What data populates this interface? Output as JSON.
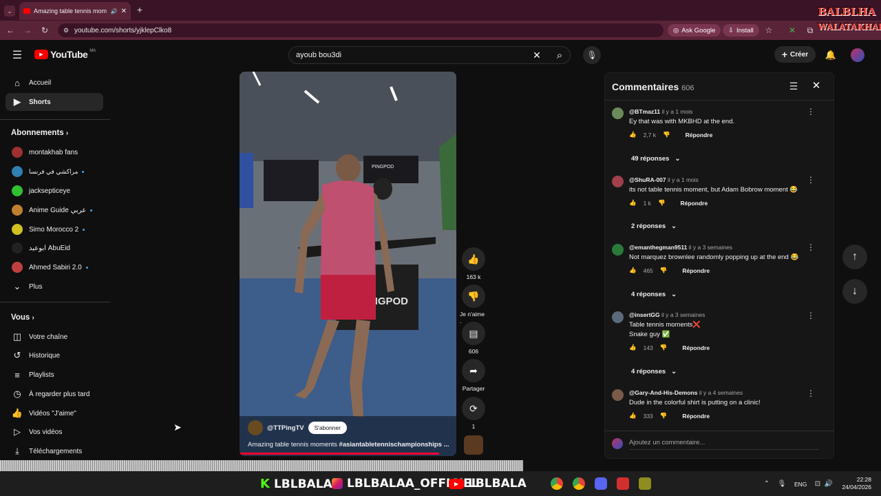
{
  "browser": {
    "tab_title": "Amazing table tennis mom",
    "url": "youtube.com/shorts/yjklepClko8",
    "ask_google": "Ask Google",
    "install": "Install"
  },
  "header": {
    "logo_text": "YouTube",
    "logo_region": "MA",
    "search_value": "ayoub bou3di",
    "create_label": "Créer"
  },
  "sidebar": {
    "nav": [
      {
        "label": "Accueil",
        "icon": "home-icon"
      },
      {
        "label": "Shorts",
        "icon": "shorts-icon"
      }
    ],
    "subs_title": "Abonnements",
    "subs": [
      {
        "label": "montakhab fans",
        "dot": false
      },
      {
        "label": "مراكشي في فرنسا",
        "dot": true
      },
      {
        "label": "jacksepticeye",
        "dot": false
      },
      {
        "label": "Anime Guide عربي",
        "dot": true
      },
      {
        "label": "Simo Morocco 2",
        "dot": true
      },
      {
        "label": "ابوعيد AbuEid",
        "dot": false
      },
      {
        "label": "Ahmed Sabiri 2.0",
        "dot": true
      }
    ],
    "more": "Plus",
    "you_title": "Vous",
    "you": [
      {
        "label": "Votre chaîne",
        "icon": "channel-icon"
      },
      {
        "label": "Historique",
        "icon": "history-icon"
      },
      {
        "label": "Playlists",
        "icon": "playlist-icon"
      },
      {
        "label": "À regarder plus tard",
        "icon": "clock-icon"
      },
      {
        "label": "Vidéos \"J'aime\"",
        "icon": "like-icon"
      },
      {
        "label": "Vos vidéos",
        "icon": "video-icon"
      },
      {
        "label": "Téléchargements",
        "icon": "download-icon"
      }
    ]
  },
  "short": {
    "channel": "@TTPingTV",
    "subscribe": "S'abonner",
    "title": "Amazing table tennis moments ",
    "hashtag": "#asiantabletennischampionships ...",
    "brand_sign": "PINGPOD",
    "table_text": "NGPOD"
  },
  "actions": {
    "likes": "163 k",
    "dislike": "Je n'aime .",
    "comments": "606",
    "share": "Partager",
    "remix": "1"
  },
  "comments": {
    "title": "Commentaires",
    "count": "606",
    "reply_label": "Répondre",
    "add_placeholder": "Ajoutez un commentaire...",
    "items": [
      {
        "author": "@BTmaz11",
        "time": "il y a 1 mois",
        "text": "Ey that was with MKBHD at the end.",
        "likes": "2,7 k",
        "replies": "49 réponses",
        "color": "#6a8a5a"
      },
      {
        "author": "@ShuRA-007",
        "time": "il y a 1 mois",
        "text": "its not table tennis moment, but Adam Bobrow moment 😂",
        "likes": "1 k",
        "replies": "2 réponses",
        "color": "#a0404a"
      },
      {
        "author": "@emanthegman9511",
        "time": "il y a 3 semaines",
        "text": "Not marquez brownlee randomly popping up at the end 😂",
        "likes": "465",
        "replies": "4 réponses",
        "color": "#2a7a3a"
      },
      {
        "author": "@insertGG",
        "time": "il y a 3 semaines",
        "text": "Table tennis moments❌",
        "text2": "Snake guy ✅",
        "likes": "143",
        "replies": "4 réponses",
        "color": "#5a6a7a"
      },
      {
        "author": "@Gary-And-His-Demons",
        "time": "il y a 4 semaines",
        "text": "Dude in the colorful shirt is putting on a clinic!",
        "likes": "333",
        "replies": "",
        "color": "#7a5a4a"
      }
    ]
  },
  "overlay": {
    "logo_line1": "BALBLHA",
    "logo_line2": "WALATAKHAF",
    "promo1": "LBLBALAA",
    "promo2": "LBLBALAA_OFFICIEL",
    "promo3": "LBLBALA"
  },
  "taskbar": {
    "lang": "ENG",
    "time": "22:28",
    "date": "24/04/2026"
  }
}
